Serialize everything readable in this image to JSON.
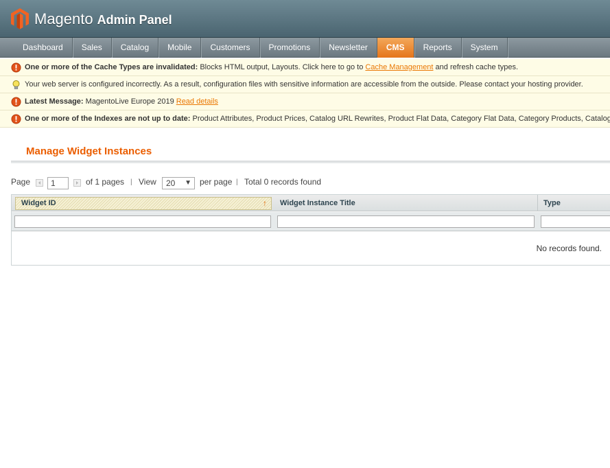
{
  "header": {
    "brand": "Magento",
    "suffix": "Admin Panel"
  },
  "nav": {
    "items": [
      "Dashboard",
      "Sales",
      "Catalog",
      "Mobile",
      "Customers",
      "Promotions",
      "Newsletter",
      "CMS",
      "Reports",
      "System"
    ],
    "active": "CMS"
  },
  "messages": {
    "cache": {
      "bold": "One or more of the Cache Types are invalidated:",
      "text": " Blocks HTML output, Layouts. Click here to go to ",
      "link": "Cache Management",
      "after": " and refresh cache types."
    },
    "server": {
      "text": "Your web server is configured incorrectly. As a result, configuration files with sensitive information are accessible from the outside. Please contact your hosting provider."
    },
    "latest": {
      "bold": "Latest Message:",
      "text": " MagentoLive Europe 2019 ",
      "link": "Read details"
    },
    "indexes": {
      "bold": "One or more of the Indexes are not up to date:",
      "text": " Product Attributes, Product Prices, Catalog URL Rewrites, Product Flat Data, Category Flat Data, Category Products, Catalog"
    }
  },
  "page": {
    "title": "Manage Widget Instances"
  },
  "pager": {
    "page_label": "Page",
    "page_value": "1",
    "of_pages": "of 1 pages",
    "sep": "|",
    "view_label": "View",
    "view_value": "20",
    "per_page": "per page",
    "sep2": "|",
    "total": "Total 0 records found"
  },
  "grid": {
    "columns": [
      "Widget ID",
      "Widget Instance Title",
      "Type"
    ],
    "sort_arrow": "↑",
    "empty": "No records found."
  },
  "colors": {
    "accent": "#eb5e00",
    "link": "#ea7601",
    "nav_active": "#e5751a"
  }
}
